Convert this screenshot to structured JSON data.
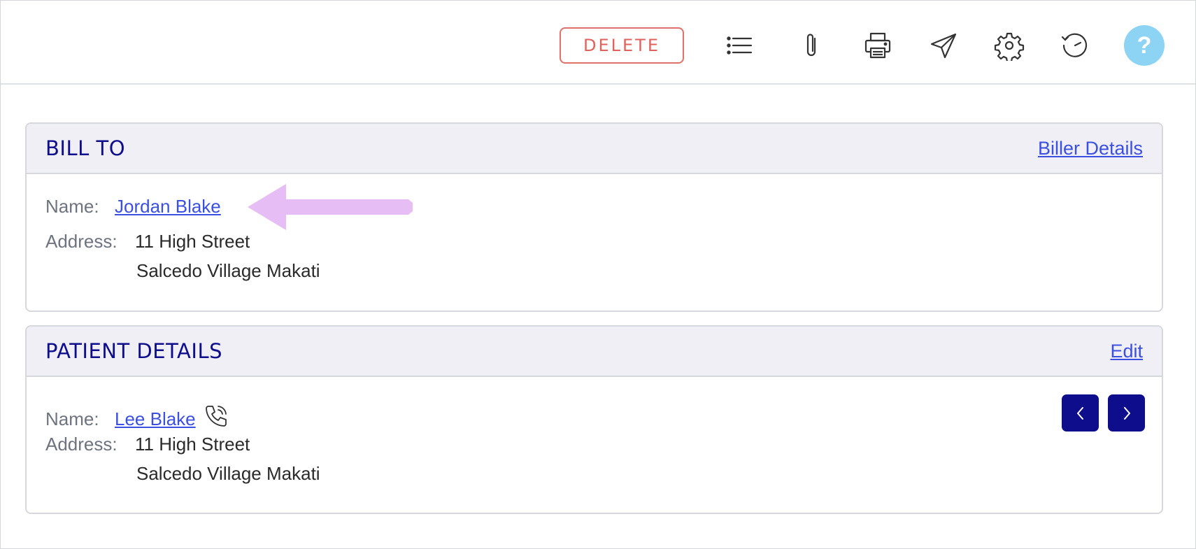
{
  "toolbar": {
    "delete_label": "DELETE",
    "icons": [
      "list-icon",
      "paperclip-icon",
      "printer-icon",
      "send-icon",
      "gear-icon",
      "history-icon"
    ],
    "help_label": "?",
    "help_color": "#8dd3f3",
    "delete_color": "#e0625c"
  },
  "bill_to": {
    "title": "BILL TO",
    "action_label": "Biller Details",
    "name_label": "Name:",
    "name_value": "Jordan Blake",
    "address_label": "Address:",
    "address_line1": "11 High Street",
    "address_line2": "Salcedo Village Makati"
  },
  "patient_details": {
    "title": "PATIENT DETAILS",
    "action_label": "Edit",
    "name_label": "Name:",
    "name_value": "Lee Blake ",
    "address_label": "Address:",
    "address_line1": "11 High Street",
    "address_line2": "Salcedo Village Makati",
    "nav_icons": [
      "chevron-left-icon",
      "chevron-right-icon"
    ]
  },
  "colors": {
    "heading": "#0e0e8c",
    "link": "#3b4fe0",
    "annotation_arrow": "#e6bdf5"
  }
}
